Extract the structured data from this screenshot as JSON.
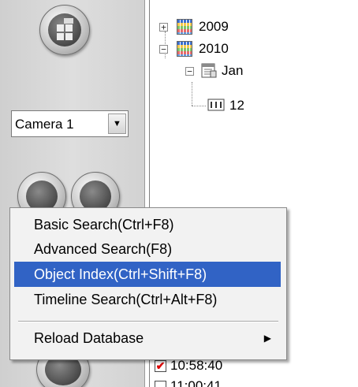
{
  "camera_select": {
    "value": "Camera 1",
    "arrow": "▼"
  },
  "tree": {
    "nodes": [
      {
        "expander": "+",
        "label": "2009"
      },
      {
        "expander": "−",
        "label": "2010"
      },
      {
        "expander": "−",
        "label": "Jan"
      },
      {
        "label": "12"
      }
    ]
  },
  "recordings": [
    {
      "time": "10:58:40",
      "checked": true
    },
    {
      "time": "11:00:41",
      "checked": false
    }
  ],
  "context_menu": {
    "items": [
      {
        "label": "Basic Search(Ctrl+F8)"
      },
      {
        "label": "Advanced Search(F8)"
      },
      {
        "label": "Object Index(Ctrl+Shift+F8)",
        "highlighted": true
      },
      {
        "label": "Timeline Search(Ctrl+Alt+F8)"
      },
      {
        "label": "Reload Database",
        "has_submenu": true
      }
    ],
    "submenu_arrow": "▶"
  },
  "icons": [
    "layout-icon",
    "search-icon",
    "playback-icon",
    "avi-export-icon",
    "calendar-icon",
    "day-icon",
    "chevron-down-icon",
    "chevron-right-icon",
    "checkmark-icon"
  ],
  "colors": {
    "menu_highlight": "#3163c5",
    "panel_gray": "#d6d6d6",
    "check_red": "#dd0000"
  }
}
